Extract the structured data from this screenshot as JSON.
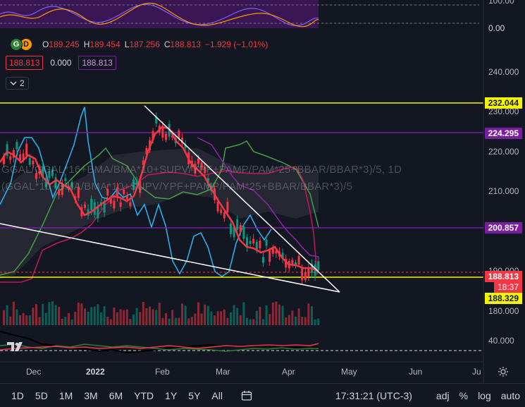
{
  "oscillator": {
    "top_value": "100.00",
    "bottom_value": "0.00"
  },
  "legend": {
    "open_label": "O",
    "open_value": "189.245",
    "high_label": "H",
    "high_value": "189.454",
    "low_label": "L",
    "low_value": "187.256",
    "close_label": "C",
    "close_value": "188.813",
    "change": "−1.929 (−1.01%)",
    "symbol_icon_1": "G",
    "symbol_icon_2": "D"
  },
  "indicator_values": {
    "red": "188.813",
    "plain": "0.000",
    "purple": "188.813"
  },
  "collapse": {
    "label": "2",
    "icon": "chevron-down-icon"
  },
  "overlay_lines": [
    "GGAL/GGAL*16+BMA/BMA*10+SUPV/YPF+PAMP/PAM*25+BBAR/BBAR*3)/5, 1D",
    "(GGAL*10+BMA/BMA*10+SUPV/YPF+PAMP/PAM*25+BBAR/BBAR*3)/5"
  ],
  "price_axis": {
    "labels": [
      "240.000",
      "230.000",
      "220.000",
      "210.000",
      "200.000",
      "190.000",
      "180.000",
      "40.000"
    ]
  },
  "price_tags": {
    "yellow_top": "232.044",
    "purple_top": "224.295",
    "purple_mid": "200.857",
    "last_price": "188.813",
    "countdown": "18:37",
    "yellow_bottom": "188.329"
  },
  "time_axis": {
    "labels": [
      "Dec",
      "2022",
      "Feb",
      "Mar",
      "Apr",
      "May",
      "Jun",
      "Ju"
    ]
  },
  "bottom_bar": {
    "ranges": [
      "1D",
      "5D",
      "1M",
      "3M",
      "6M",
      "YTD",
      "1Y",
      "5Y",
      "All"
    ],
    "time": "17:31:21 (UTC-3)",
    "adj": "adj",
    "percent": "%",
    "log": "log",
    "auto": "auto",
    "calendar_icon": "calendar-icon",
    "settings_icon": "gear-icon"
  },
  "colors": {
    "background": "#131722",
    "up": "#089981",
    "down": "#f23645",
    "yellow": "#f5f500",
    "purple": "#7b1fa2",
    "osc_band": "#4a1f6b"
  }
}
